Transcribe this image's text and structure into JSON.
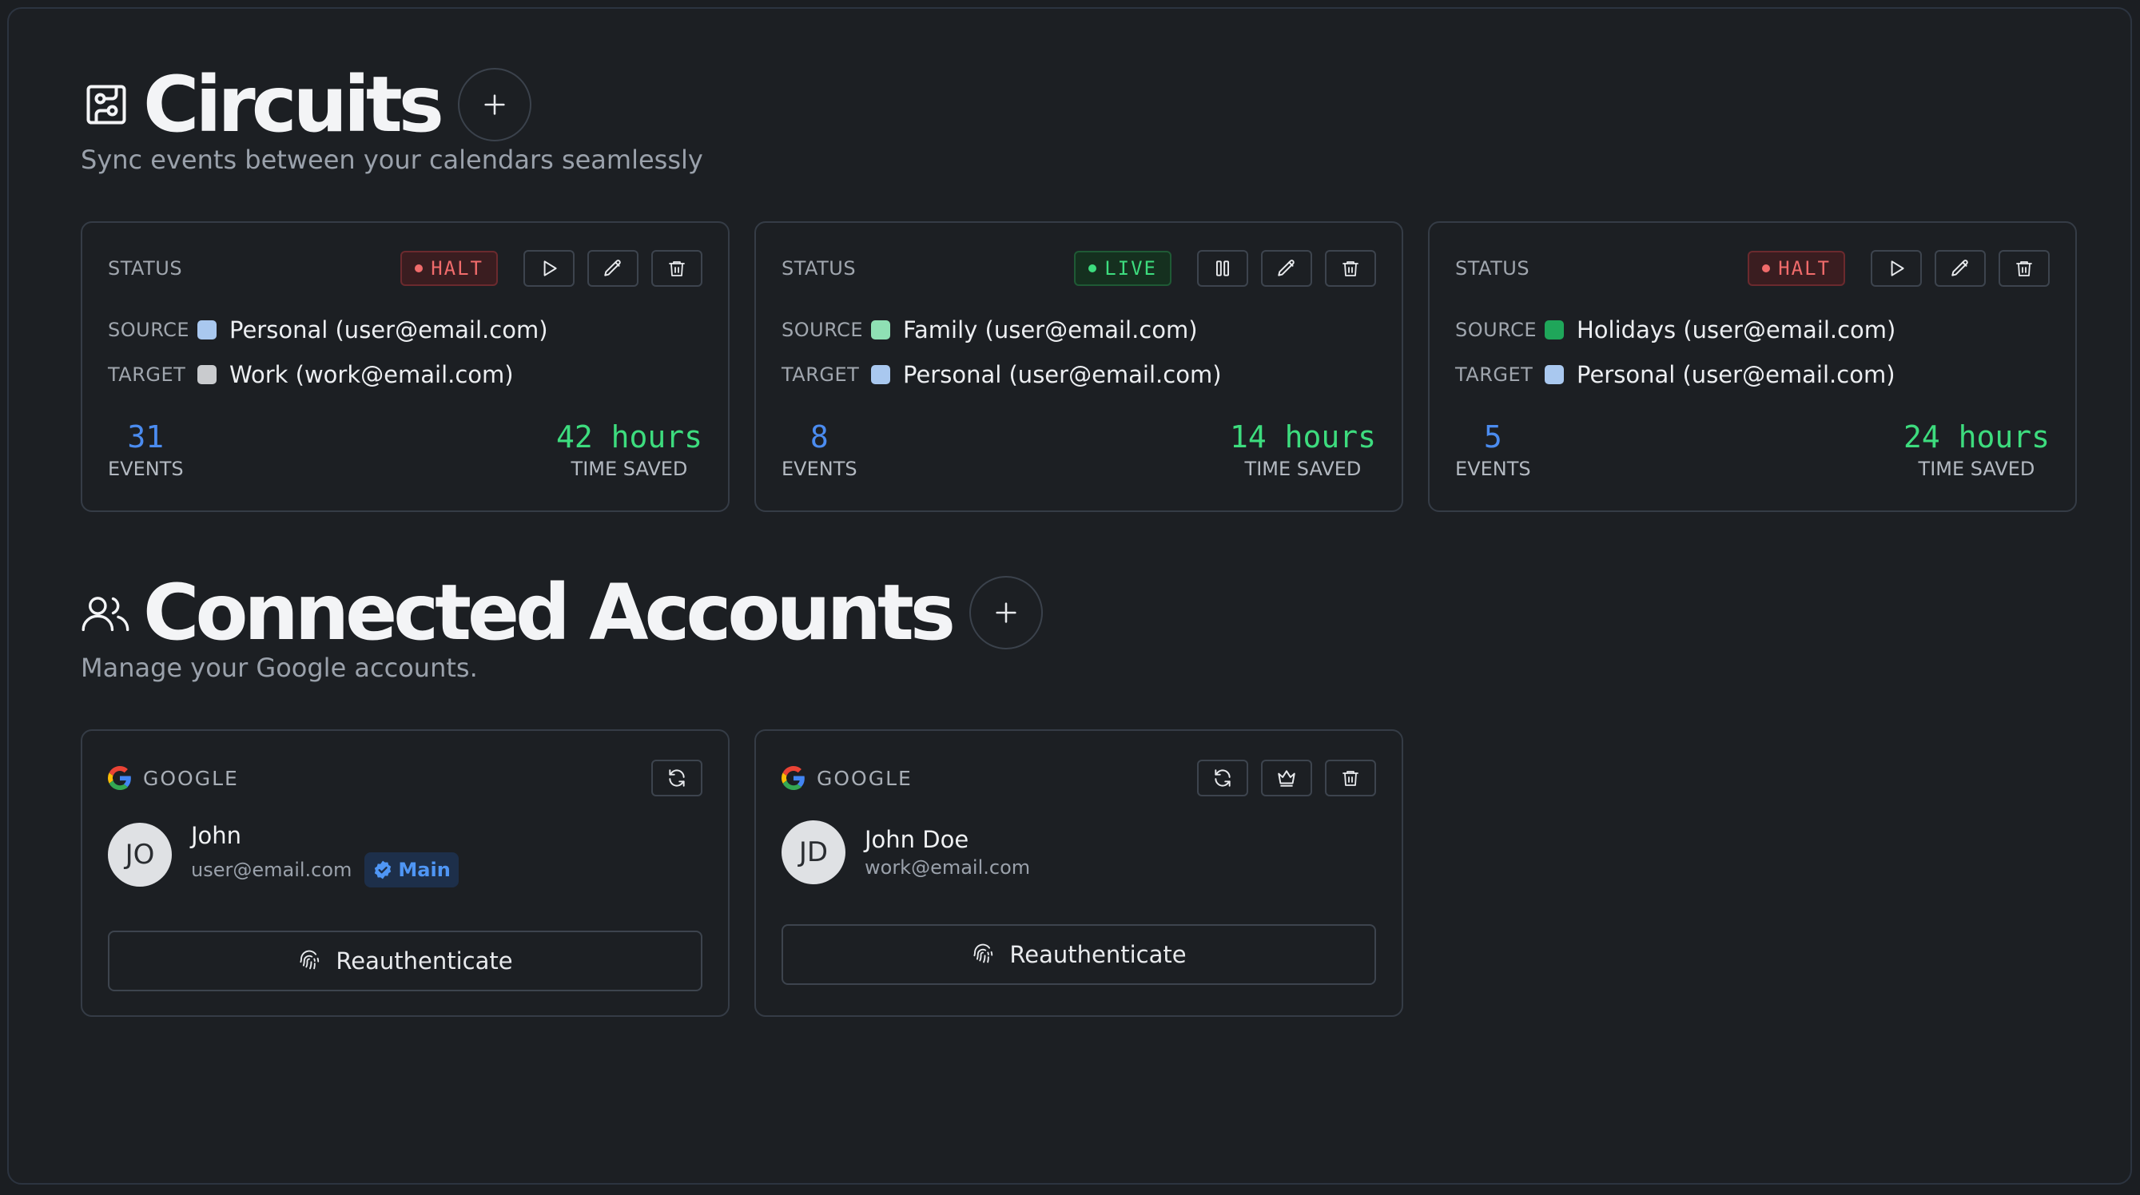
{
  "circuits": {
    "title": "Circuits",
    "subtitle": "Sync events between your calendars seamlessly",
    "icon": "circuit-board-icon",
    "cards": [
      {
        "status_label": "STATUS",
        "status": "HALT",
        "source_label": "SOURCE",
        "source": "Personal (user@email.com)",
        "source_color": "#a9c8ef",
        "target_label": "TARGET",
        "target": "Work (work@email.com)",
        "target_color": "#c9cbce",
        "events": "31",
        "events_label": "EVENTS",
        "time_saved": "42 hours",
        "time_saved_label": "TIME SAVED"
      },
      {
        "status_label": "STATUS",
        "status": "LIVE",
        "source_label": "SOURCE",
        "source": "Family (user@email.com)",
        "source_color": "#8fe0b4",
        "target_label": "TARGET",
        "target": "Personal (user@email.com)",
        "target_color": "#a9c8ef",
        "events": "8",
        "events_label": "EVENTS",
        "time_saved": "14 hours",
        "time_saved_label": "TIME SAVED"
      },
      {
        "status_label": "STATUS",
        "status": "HALT",
        "source_label": "SOURCE",
        "source": "Holidays (user@email.com)",
        "source_color": "#1fa65a",
        "target_label": "TARGET",
        "target": "Personal (user@email.com)",
        "target_color": "#a9c8ef",
        "events": "5",
        "events_label": "EVENTS",
        "time_saved": "24 hours",
        "time_saved_label": "TIME SAVED"
      }
    ]
  },
  "accounts": {
    "title": "Connected Accounts",
    "subtitle": "Manage your Google accounts.",
    "icon": "users-icon",
    "cards": [
      {
        "provider": "GOOGLE",
        "initials": "JO",
        "name": "John",
        "email": "user@email.com",
        "badge": "Main",
        "reauth_label": "Reauthenticate"
      },
      {
        "provider": "GOOGLE",
        "initials": "JD",
        "name": "John Doe",
        "email": "work@email.com",
        "reauth_label": "Reauthenticate"
      }
    ]
  },
  "colors": {
    "background": "#1c1f23",
    "halt": "#f06b6b",
    "live": "#3ddc7e",
    "events": "#4b8cf0",
    "main_badge": "#4f96f5"
  }
}
